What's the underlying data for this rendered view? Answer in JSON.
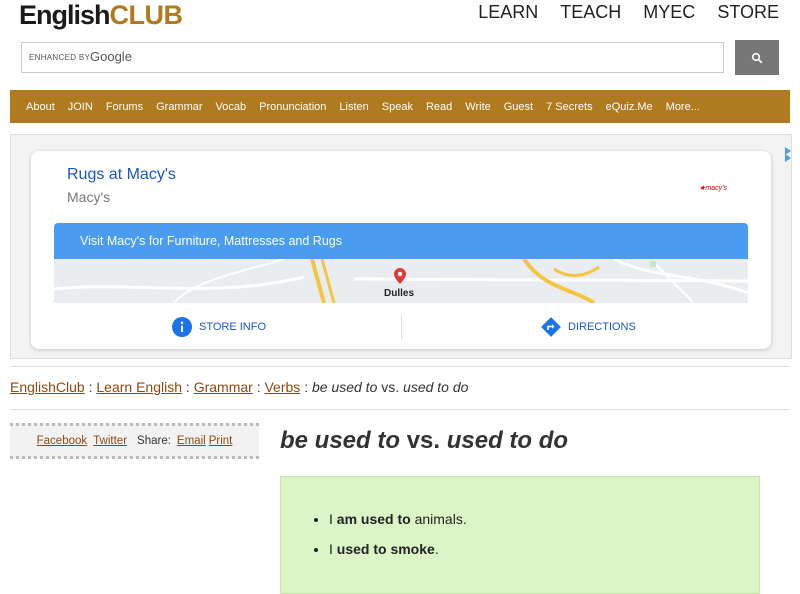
{
  "brand": {
    "logo_main": "English",
    "logo_club": "CLUB"
  },
  "topnav": [
    "LEARN",
    "TEACH",
    "MYEC",
    "STORE"
  ],
  "search": {
    "enhanced_by": "ENHANCED BY",
    "google": "Google"
  },
  "nav": [
    "About",
    "JOIN",
    "Forums",
    "Grammar",
    "Vocab",
    "Pronunciation",
    "Listen",
    "Speak",
    "Read",
    "Write",
    "Guest",
    "7 Secrets",
    "eQuiz.Me",
    "More..."
  ],
  "ad": {
    "title": "Rugs at Macy's",
    "advertiser": "Macy's",
    "brand_mark": "★macy's",
    "cta": "Visit Macy's for Furniture, Mattresses and Rugs",
    "map_place": "Dulles",
    "store_info": "STORE INFO",
    "directions": "DIRECTIONS"
  },
  "breadcrumb": {
    "items": [
      "EnglishClub",
      "Learn English",
      "Grammar",
      "Verbs"
    ],
    "sep": ":",
    "current_a": "be used to",
    "current_vs": "vs.",
    "current_b": "used to do"
  },
  "share": {
    "facebook": "Facebook",
    "twitter": "Twitter",
    "share_label": "Share:",
    "email": "Email",
    "print": "Print"
  },
  "page": {
    "title_a": "be used to",
    "title_vs": "vs.",
    "title_b": "used to do",
    "examples": [
      {
        "pre": "I ",
        "bold": "am used to",
        "post": " animals."
      },
      {
        "pre": "I ",
        "bold": "used to smoke",
        "post": "."
      }
    ]
  },
  "colors": {
    "brand": "#b07a1e",
    "link": "#8a4a12",
    "ad_blue": "#4a9cf0",
    "example_bg": "#dcf5c7"
  }
}
